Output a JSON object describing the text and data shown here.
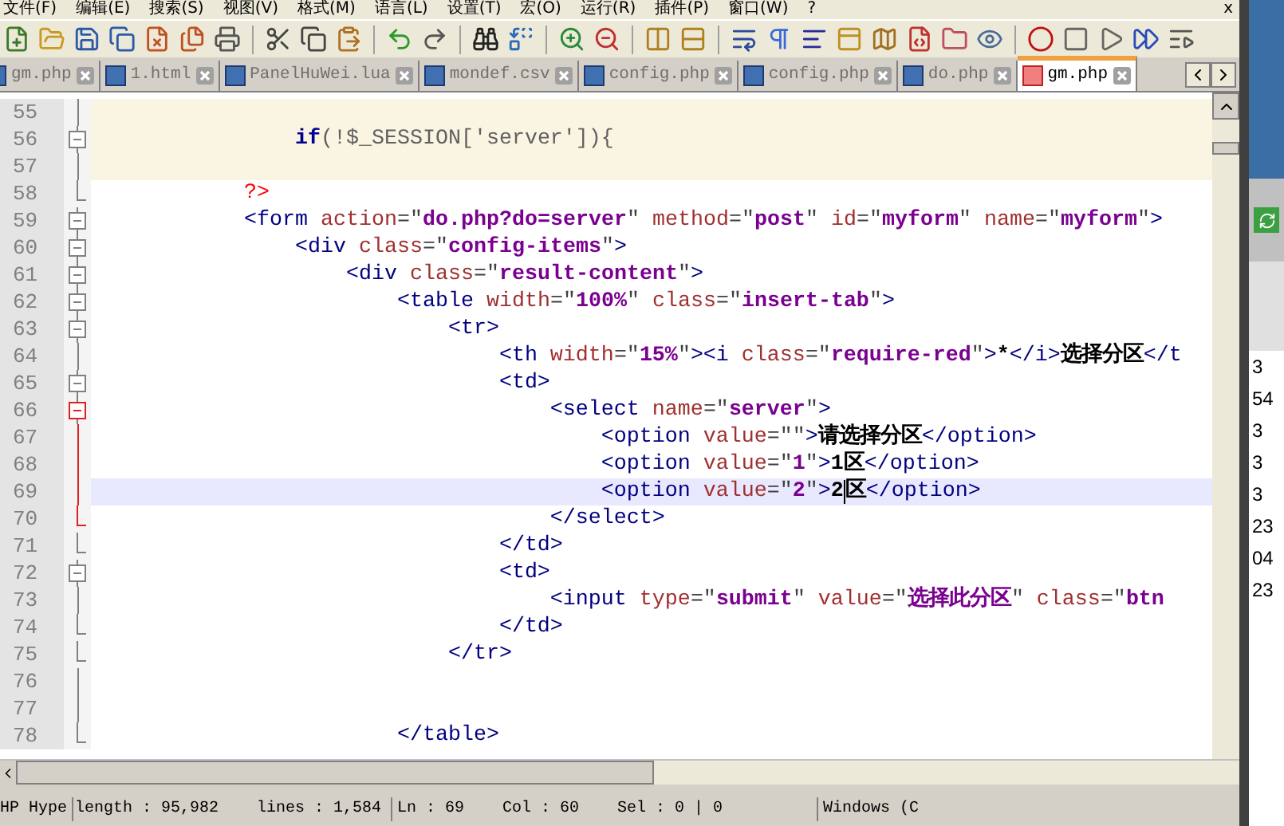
{
  "menu": [
    "文件(F)",
    "编辑(E)",
    "搜索(S)",
    "视图(V)",
    "格式(M)",
    "语言(L)",
    "设置(T)",
    "宏(O)",
    "运行(R)",
    "插件(P)",
    "窗口(W)",
    "?"
  ],
  "menu_close": "x",
  "tabs": [
    {
      "label": "gm.php",
      "selected": false,
      "modified": false
    },
    {
      "label": "1.html",
      "selected": false,
      "modified": false
    },
    {
      "label": "PanelHuWei.lua",
      "selected": false,
      "modified": false
    },
    {
      "label": "mondef.csv",
      "selected": false,
      "modified": false
    },
    {
      "label": "config.php",
      "selected": false,
      "modified": false
    },
    {
      "label": "config.php",
      "selected": false,
      "modified": false
    },
    {
      "label": "do.php",
      "selected": false,
      "modified": false
    },
    {
      "label": "gm.php",
      "selected": true,
      "modified": true
    }
  ],
  "lines": [
    {
      "number": "55",
      "kind": "fold_middle",
      "active": false,
      "current": false,
      "php": true
    },
    {
      "number": "56",
      "kind": "fold_start",
      "active": false,
      "current": false,
      "php": true,
      "tokens": [
        {
          "kind": "php_keyword",
          "text": "                if"
        },
        {
          "kind": "php",
          "text": "(!$_SESSION['server']){"
        }
      ]
    },
    {
      "number": "57",
      "kind": "fold_middle",
      "active": false,
      "current": false,
      "php": true
    },
    {
      "number": "58",
      "kind": "fold_end",
      "active": false,
      "current": false,
      "php": false,
      "tokens": [
        {
          "kind": "php_end",
          "text": "            ?>"
        }
      ]
    },
    {
      "number": "59",
      "kind": "fold_start",
      "active": false,
      "current": false,
      "php": false,
      "tokens": [
        {
          "kind": "tag",
          "text": "            <form"
        },
        {
          "kind": "attr",
          "text": " action"
        },
        {
          "kind": "punct",
          "text": "=\""
        },
        {
          "kind": "value",
          "text": "do.php?do=server"
        },
        {
          "kind": "punct",
          "text": "\""
        },
        {
          "kind": "attr",
          "text": " method"
        },
        {
          "kind": "punct",
          "text": "=\""
        },
        {
          "kind": "value",
          "text": "post"
        },
        {
          "kind": "punct",
          "text": "\""
        },
        {
          "kind": "attr",
          "text": " id"
        },
        {
          "kind": "punct",
          "text": "=\""
        },
        {
          "kind": "value",
          "text": "myform"
        },
        {
          "kind": "punct",
          "text": "\""
        },
        {
          "kind": "attr",
          "text": " name"
        },
        {
          "kind": "punct",
          "text": "=\""
        },
        {
          "kind": "value",
          "text": "myform"
        },
        {
          "kind": "punct",
          "text": "\""
        },
        {
          "kind": "tag",
          "text": ">"
        }
      ]
    },
    {
      "number": "60",
      "kind": "fold_start",
      "active": false,
      "current": false,
      "php": false,
      "tokens": [
        {
          "kind": "tag",
          "text": "                <div"
        },
        {
          "kind": "attr",
          "text": " class"
        },
        {
          "kind": "punct",
          "text": "=\""
        },
        {
          "kind": "value",
          "text": "config-items"
        },
        {
          "kind": "punct",
          "text": "\""
        },
        {
          "kind": "tag",
          "text": ">"
        }
      ]
    },
    {
      "number": "61",
      "kind": "fold_start",
      "active": false,
      "current": false,
      "php": false,
      "tokens": [
        {
          "kind": "tag",
          "text": "                    <div"
        },
        {
          "kind": "attr",
          "text": " class"
        },
        {
          "kind": "punct",
          "text": "=\""
        },
        {
          "kind": "value",
          "text": "result-content"
        },
        {
          "kind": "punct",
          "text": "\""
        },
        {
          "kind": "tag",
          "text": ">"
        }
      ]
    },
    {
      "number": "62",
      "kind": "fold_start",
      "active": false,
      "current": false,
      "php": false,
      "tokens": [
        {
          "kind": "tag",
          "text": "                        <table"
        },
        {
          "kind": "attr",
          "text": " width"
        },
        {
          "kind": "punct",
          "text": "=\""
        },
        {
          "kind": "value",
          "text": "100%"
        },
        {
          "kind": "punct",
          "text": "\""
        },
        {
          "kind": "attr",
          "text": " class"
        },
        {
          "kind": "punct",
          "text": "=\""
        },
        {
          "kind": "value",
          "text": "insert-tab"
        },
        {
          "kind": "punct",
          "text": "\""
        },
        {
          "kind": "tag",
          "text": ">"
        }
      ]
    },
    {
      "number": "63",
      "kind": "fold_start",
      "active": false,
      "current": false,
      "php": false,
      "tokens": [
        {
          "kind": "tag",
          "text": "                            <tr>"
        }
      ]
    },
    {
      "number": "64",
      "kind": "fold_middle",
      "active": false,
      "current": false,
      "php": false,
      "tokens": [
        {
          "kind": "tag",
          "text": "                                <th"
        },
        {
          "kind": "attr",
          "text": " width"
        },
        {
          "kind": "punct",
          "text": "=\""
        },
        {
          "kind": "value",
          "text": "15%"
        },
        {
          "kind": "punct",
          "text": "\""
        },
        {
          "kind": "tag",
          "text": "><i"
        },
        {
          "kind": "attr",
          "text": " class"
        },
        {
          "kind": "punct",
          "text": "=\""
        },
        {
          "kind": "value",
          "text": "require-red"
        },
        {
          "kind": "punct",
          "text": "\""
        },
        {
          "kind": "tag",
          "text": ">"
        },
        {
          "kind": "text",
          "text": "*"
        },
        {
          "kind": "tag",
          "text": "</i>"
        },
        {
          "kind": "text",
          "text": "选择分区"
        },
        {
          "kind": "tag",
          "text": "</t"
        }
      ]
    },
    {
      "number": "65",
      "kind": "fold_start",
      "active": false,
      "current": false,
      "php": false,
      "tokens": [
        {
          "kind": "tag",
          "text": "                                <td>"
        }
      ]
    },
    {
      "number": "66",
      "kind": "fold_start",
      "active": true,
      "current": false,
      "php": false,
      "tokens": [
        {
          "kind": "tag",
          "text": "                                    <select"
        },
        {
          "kind": "attr",
          "text": " name"
        },
        {
          "kind": "punct",
          "text": "=\""
        },
        {
          "kind": "value",
          "text": "server"
        },
        {
          "kind": "punct",
          "text": "\""
        },
        {
          "kind": "tag",
          "text": ">"
        }
      ]
    },
    {
      "number": "67",
      "kind": "fold_middle",
      "active": true,
      "current": false,
      "php": false,
      "tokens": [
        {
          "kind": "tag",
          "text": "                                        <option"
        },
        {
          "kind": "attr",
          "text": " value"
        },
        {
          "kind": "punct",
          "text": "=\"\""
        },
        {
          "kind": "tag",
          "text": ">"
        },
        {
          "kind": "text",
          "text": "请选择分区"
        },
        {
          "kind": "tag",
          "text": "</option>"
        }
      ]
    },
    {
      "number": "68",
      "kind": "fold_middle",
      "active": true,
      "current": false,
      "php": false,
      "tokens": [
        {
          "kind": "tag",
          "text": "                                        <option"
        },
        {
          "kind": "attr",
          "text": " value"
        },
        {
          "kind": "punct",
          "text": "=\""
        },
        {
          "kind": "value",
          "text": "1"
        },
        {
          "kind": "punct",
          "text": "\""
        },
        {
          "kind": "tag",
          "text": ">"
        },
        {
          "kind": "text",
          "text": "1区"
        },
        {
          "kind": "tag",
          "text": "</option>"
        }
      ]
    },
    {
      "number": "69",
      "kind": "fold_middle",
      "active": true,
      "current": true,
      "php": false,
      "tokens": [
        {
          "kind": "tag",
          "text": "                                        <option"
        },
        {
          "kind": "attr",
          "text": " value"
        },
        {
          "kind": "punct",
          "text": "=\""
        },
        {
          "kind": "value",
          "text": "2"
        },
        {
          "kind": "punct",
          "text": "\""
        },
        {
          "kind": "tag",
          "text": ">"
        },
        {
          "kind": "text",
          "text": "2",
          "caret": true
        },
        {
          "kind": "text",
          "text": "区"
        },
        {
          "kind": "tag",
          "text": "</option>"
        }
      ]
    },
    {
      "number": "70",
      "kind": "fold_end",
      "active": true,
      "current": false,
      "php": false,
      "tokens": [
        {
          "kind": "tag",
          "text": "                                    </select>"
        }
      ]
    },
    {
      "number": "71",
      "kind": "fold_end",
      "active": false,
      "current": false,
      "php": false,
      "tokens": [
        {
          "kind": "tag",
          "text": "                                </td>"
        }
      ]
    },
    {
      "number": "72",
      "kind": "fold_start",
      "active": false,
      "current": false,
      "php": false,
      "tokens": [
        {
          "kind": "tag",
          "text": "                                <td>"
        }
      ]
    },
    {
      "number": "73",
      "kind": "fold_middle",
      "active": false,
      "current": false,
      "php": false,
      "tokens": [
        {
          "kind": "tag",
          "text": "                                    <input"
        },
        {
          "kind": "attr",
          "text": " type"
        },
        {
          "kind": "punct",
          "text": "=\""
        },
        {
          "kind": "value",
          "text": "submit"
        },
        {
          "kind": "punct",
          "text": "\""
        },
        {
          "kind": "attr",
          "text": " value"
        },
        {
          "kind": "punct",
          "text": "=\""
        },
        {
          "kind": "value",
          "text": "选择此分区"
        },
        {
          "kind": "punct",
          "text": "\""
        },
        {
          "kind": "attr",
          "text": " class"
        },
        {
          "kind": "punct",
          "text": "=\""
        },
        {
          "kind": "value",
          "text": "btn"
        }
      ]
    },
    {
      "number": "74",
      "kind": "fold_end",
      "active": false,
      "current": false,
      "php": false,
      "tokens": [
        {
          "kind": "tag",
          "text": "                                </td>"
        }
      ]
    },
    {
      "number": "75",
      "kind": "fold_end",
      "active": false,
      "current": false,
      "php": false,
      "tokens": [
        {
          "kind": "tag",
          "text": "                            </tr>"
        }
      ]
    },
    {
      "number": "76",
      "kind": "fold_middle",
      "active": false,
      "current": false,
      "php": false
    },
    {
      "number": "77",
      "kind": "fold_middle",
      "active": false,
      "current": false,
      "php": false
    },
    {
      "number": "78",
      "kind": "fold_end",
      "active": false,
      "current": false,
      "php": false,
      "tokens": [
        {
          "kind": "tag",
          "text": "                        </table>"
        }
      ]
    }
  ],
  "background_window": {
    "values": [
      "3",
      "54",
      "3",
      "3",
      "3",
      "23",
      "04",
      "23"
    ]
  },
  "status_bar": {
    "file_type": "HP Hype",
    "length": "length : 95,982",
    "lines": "lines : 1,584",
    "line": "Ln : 69",
    "column": "Col : 60",
    "selection": "Sel : 0 | 0",
    "eol": "Windows (C"
  }
}
